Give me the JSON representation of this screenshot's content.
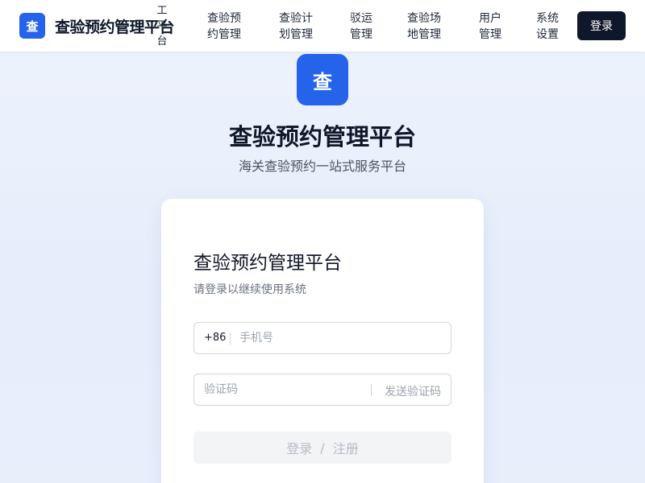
{
  "header": {
    "logo_char": "查",
    "app_name": "查验预约管理平台",
    "nav_stack": [
      "工",
      "平",
      "台"
    ],
    "nav": [
      {
        "label": "查验预约管理"
      },
      {
        "label": "查验计划管理"
      },
      {
        "label": "驳运管理"
      },
      {
        "label": "查验场地管理"
      },
      {
        "label": "用户管理"
      },
      {
        "label": "系统设置"
      }
    ],
    "login_label": "登录"
  },
  "hero": {
    "logo_char": "查",
    "title": "查验预约管理平台",
    "subtitle": "海关查验预约一站式服务平台"
  },
  "card": {
    "title": "查验预约管理平台",
    "subtitle": "请登录以继续使用系统",
    "phone": {
      "prefix": "+86",
      "placeholder": "手机号",
      "value": ""
    },
    "code": {
      "placeholder": "验证码",
      "value": "",
      "send_label": "发送验证码"
    },
    "submit": {
      "login": "登录",
      "separator": "/",
      "register": "注册"
    }
  },
  "colors": {
    "accent": "#2563eb",
    "dark_button": "#0f172a",
    "page_bg": "#e9eefb"
  }
}
